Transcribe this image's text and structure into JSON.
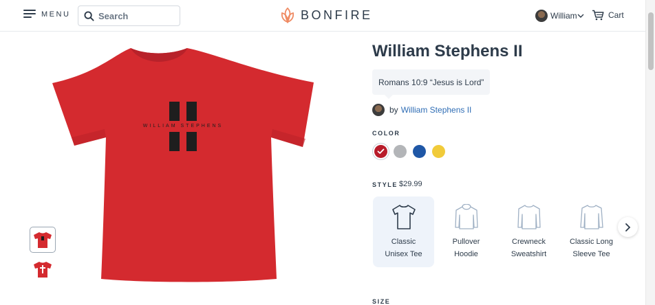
{
  "header": {
    "menu_label": "MENU",
    "search_placeholder": "Search",
    "brand": "BONFIRE",
    "user_name": "William",
    "cart_label": "Cart"
  },
  "product": {
    "title": "William Stephens II",
    "verse": "Romans 10:9 “Jesus is Lord”",
    "by_prefix": "by",
    "creator": "William Stephens II",
    "shirt_print_text": "WILLIAM STEPHENS",
    "color_label": "COLOR",
    "colors": [
      {
        "name": "red",
        "hex": "#b81c2a",
        "selected": true
      },
      {
        "name": "gray",
        "hex": "#b3b5b8",
        "selected": false
      },
      {
        "name": "royal blue",
        "hex": "#1f57a6",
        "selected": false
      },
      {
        "name": "yellow",
        "hex": "#f1cb3a",
        "selected": false
      }
    ],
    "style_label": "STYLE",
    "style_price": "$29.99",
    "styles": [
      {
        "line1": "Classic",
        "line2": "Unisex Tee",
        "active": true
      },
      {
        "line1": "Pullover",
        "line2": "Hoodie",
        "active": false
      },
      {
        "line1": "Crewneck",
        "line2": "Sweatshirt",
        "active": false
      },
      {
        "line1": "Classic Long",
        "line2": "Sleeve Tee",
        "active": false
      }
    ],
    "size_label": "SIZE"
  },
  "colors": {
    "shirt": "#d42a2f",
    "text": "#2d3b4a",
    "link": "#2f6db5",
    "brand_accent": "#ef8a62"
  }
}
